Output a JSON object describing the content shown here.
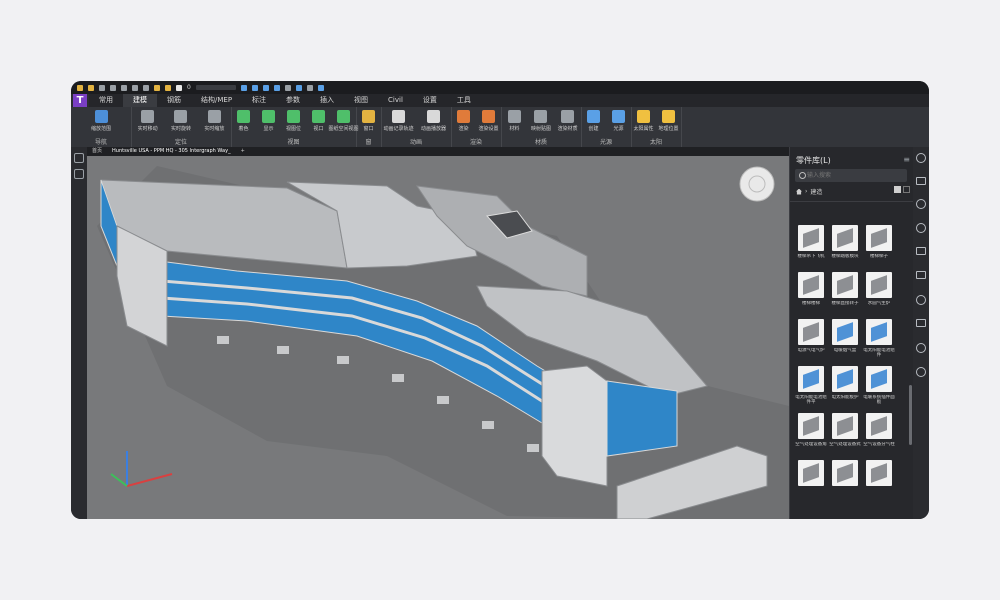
{
  "quick_access": {
    "counter": "0"
  },
  "logo": {
    "letter": "T"
  },
  "tabs": [
    {
      "label": "常用",
      "active": false
    },
    {
      "label": "建模",
      "active": true
    },
    {
      "label": "钢筋",
      "active": false
    },
    {
      "label": "结构/MEP",
      "active": false
    },
    {
      "label": "标注",
      "active": false
    },
    {
      "label": "参数",
      "active": false
    },
    {
      "label": "插入",
      "active": false
    },
    {
      "label": "视图",
      "active": false
    },
    {
      "label": "Civil",
      "active": false
    },
    {
      "label": "设置",
      "active": false
    },
    {
      "label": "工具",
      "active": false
    }
  ],
  "ribbon": {
    "groups": [
      {
        "label": "导航",
        "buttons": [
          "缩放范围"
        ]
      },
      {
        "label": "定位",
        "buttons": [
          "实时移动",
          "实时旋转",
          "实时缩放"
        ]
      },
      {
        "label": "视图",
        "buttons": [
          "着色",
          "显示",
          "视图位",
          "视口",
          "图纸空间视图"
        ]
      },
      {
        "label": "窗",
        "buttons": [
          "窗口"
        ]
      },
      {
        "label": "动画",
        "buttons": [
          "动画记录轨迹",
          "动画播放器"
        ]
      },
      {
        "label": "渲染",
        "buttons": [
          "渲染",
          "渲染设置"
        ]
      },
      {
        "label": "材质",
        "buttons": [
          "材料",
          "映射贴图",
          "渲染材质"
        ]
      },
      {
        "label": "光源",
        "buttons": [
          "创建",
          "光源"
        ]
      },
      {
        "label": "太阳",
        "buttons": [
          "太阳属性",
          "地理位置"
        ]
      }
    ]
  },
  "doc_tabs": [
    {
      "label": "首页",
      "active": false
    },
    {
      "label": "Huntsville USA - PPM HQ - 305 Intergraph Way_",
      "active": true
    },
    {
      "label": "+",
      "active": false
    }
  ],
  "viewport": {
    "background": "#78797b",
    "glass_color": "#2f86c8"
  },
  "panel": {
    "title": "零件库(L)",
    "search_placeholder": "输入搜索",
    "breadcrumb": [
      "建造"
    ],
    "items": [
      {
        "label": "楼梯吊下飞机",
        "icon": "stair-icon"
      },
      {
        "label": "楼梯踏板模块",
        "icon": "ramp-icon"
      },
      {
        "label": "楼梯梯子",
        "icon": "ladder-icon"
      },
      {
        "label": "楼梯楼梯",
        "icon": "stair2-icon"
      },
      {
        "label": "楼梯直接转子",
        "icon": "ramp2-icon"
      },
      {
        "label": "水圆气生炉",
        "icon": "pipe-icon"
      },
      {
        "label": "电源气电气炉",
        "icon": "cylinder-icon"
      },
      {
        "label": "电暖烟气盒",
        "icon": "panel-icon"
      },
      {
        "label": "电太阳能电池组件",
        "icon": "glass-icon"
      },
      {
        "label": "电太阳能电池组件平",
        "icon": "solar-icon"
      },
      {
        "label": "电太阳能板护",
        "icon": "solar2-icon"
      },
      {
        "label": "电暖系统插件面板",
        "icon": "solar3-icon"
      },
      {
        "label": "空气处理设备角",
        "icon": "box-icon"
      },
      {
        "label": "空气处理设备式",
        "icon": "box2-icon"
      },
      {
        "label": "空气设备分气柱",
        "icon": "box3-icon"
      },
      {
        "label": "",
        "icon": "plate-icon"
      },
      {
        "label": "",
        "icon": "plate2-icon"
      },
      {
        "label": "",
        "icon": "box4-icon"
      }
    ]
  }
}
